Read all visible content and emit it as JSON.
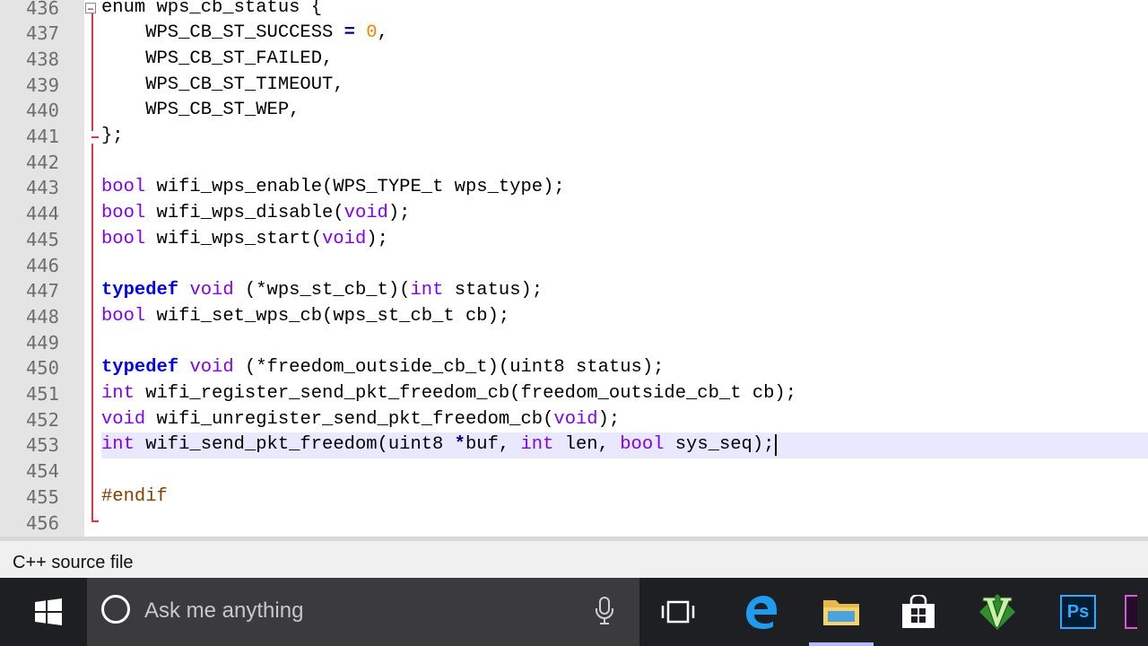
{
  "editor": {
    "lines": [
      {
        "num": "436",
        "tokens": [
          {
            "t": "enum wps_cb_status {",
            "c": ""
          }
        ]
      },
      {
        "num": "437",
        "tokens": [
          {
            "t": "    WPS_CB_ST_SUCCESS ",
            "c": ""
          },
          {
            "t": "=",
            "c": "op"
          },
          {
            "t": " ",
            "c": ""
          },
          {
            "t": "0",
            "c": "num"
          },
          {
            "t": ",",
            "c": ""
          }
        ]
      },
      {
        "num": "438",
        "tokens": [
          {
            "t": "    WPS_CB_ST_FAILED,",
            "c": ""
          }
        ]
      },
      {
        "num": "439",
        "tokens": [
          {
            "t": "    WPS_CB_ST_TIMEOUT,",
            "c": ""
          }
        ]
      },
      {
        "num": "440",
        "tokens": [
          {
            "t": "    WPS_CB_ST_WEP,",
            "c": ""
          }
        ]
      },
      {
        "num": "441",
        "tokens": [
          {
            "t": "};",
            "c": ""
          }
        ]
      },
      {
        "num": "442",
        "tokens": []
      },
      {
        "num": "443",
        "tokens": [
          {
            "t": "bool",
            "c": "ty"
          },
          {
            "t": " wifi_wps_enable(WPS_TYPE_t wps_type);",
            "c": ""
          }
        ]
      },
      {
        "num": "444",
        "tokens": [
          {
            "t": "bool",
            "c": "ty"
          },
          {
            "t": " wifi_wps_disable(",
            "c": ""
          },
          {
            "t": "void",
            "c": "ty"
          },
          {
            "t": ");",
            "c": ""
          }
        ]
      },
      {
        "num": "445",
        "tokens": [
          {
            "t": "bool",
            "c": "ty"
          },
          {
            "t": " wifi_wps_start(",
            "c": ""
          },
          {
            "t": "void",
            "c": "ty"
          },
          {
            "t": ");",
            "c": ""
          }
        ]
      },
      {
        "num": "446",
        "tokens": []
      },
      {
        "num": "447",
        "tokens": [
          {
            "t": "typedef",
            "c": "kw"
          },
          {
            "t": " ",
            "c": ""
          },
          {
            "t": "void",
            "c": "ty"
          },
          {
            "t": " (*wps_st_cb_t)(",
            "c": ""
          },
          {
            "t": "int",
            "c": "ty"
          },
          {
            "t": " status);",
            "c": ""
          }
        ]
      },
      {
        "num": "448",
        "tokens": [
          {
            "t": "bool",
            "c": "ty"
          },
          {
            "t": " wifi_set_wps_cb(wps_st_cb_t cb);",
            "c": ""
          }
        ]
      },
      {
        "num": "449",
        "tokens": []
      },
      {
        "num": "450",
        "tokens": [
          {
            "t": "typedef",
            "c": "kw"
          },
          {
            "t": " ",
            "c": ""
          },
          {
            "t": "void",
            "c": "ty"
          },
          {
            "t": " (*freedom_outside_cb_t)(uint8 status);",
            "c": ""
          }
        ]
      },
      {
        "num": "451",
        "tokens": [
          {
            "t": "int",
            "c": "ty"
          },
          {
            "t": " wifi_register_send_pkt_freedom_cb(freedom_outside_cb_t cb);",
            "c": ""
          }
        ]
      },
      {
        "num": "452",
        "tokens": [
          {
            "t": "void",
            "c": "ty"
          },
          {
            "t": " wifi_unregister_send_pkt_freedom_cb(",
            "c": ""
          },
          {
            "t": "void",
            "c": "ty"
          },
          {
            "t": ");",
            "c": ""
          }
        ]
      },
      {
        "num": "453",
        "tokens": [
          {
            "t": "int",
            "c": "ty"
          },
          {
            "t": " wifi_send_pkt_freedom(uint8 ",
            "c": ""
          },
          {
            "t": "*",
            "c": "op"
          },
          {
            "t": "buf, ",
            "c": ""
          },
          {
            "t": "int",
            "c": "ty"
          },
          {
            "t": " len, ",
            "c": ""
          },
          {
            "t": "bool",
            "c": "ty"
          },
          {
            "t": " sys_seq);",
            "c": ""
          }
        ]
      },
      {
        "num": "454",
        "tokens": []
      },
      {
        "num": "455",
        "tokens": [
          {
            "t": "#endif",
            "c": "pp"
          }
        ]
      },
      {
        "num": "456",
        "tokens": []
      }
    ],
    "current_line_index": 17,
    "colors": {
      "keyword": "#0000ff",
      "type": "#8000ff",
      "number": "#ff8000",
      "preprocessor": "#804000",
      "fold_line": "#e0363c",
      "current_line": "#e8e8ff"
    }
  },
  "statusbar": {
    "file_type": "C++ source file"
  },
  "taskbar": {
    "search_placeholder": "Ask me anything",
    "icons": [
      "windows-start-icon",
      "cortana-icon",
      "microphone-icon",
      "task-view-icon",
      "edge-icon",
      "file-explorer-icon",
      "store-icon",
      "vim-icon",
      "photoshop-icon"
    ],
    "photoshop_label": "Ps"
  }
}
